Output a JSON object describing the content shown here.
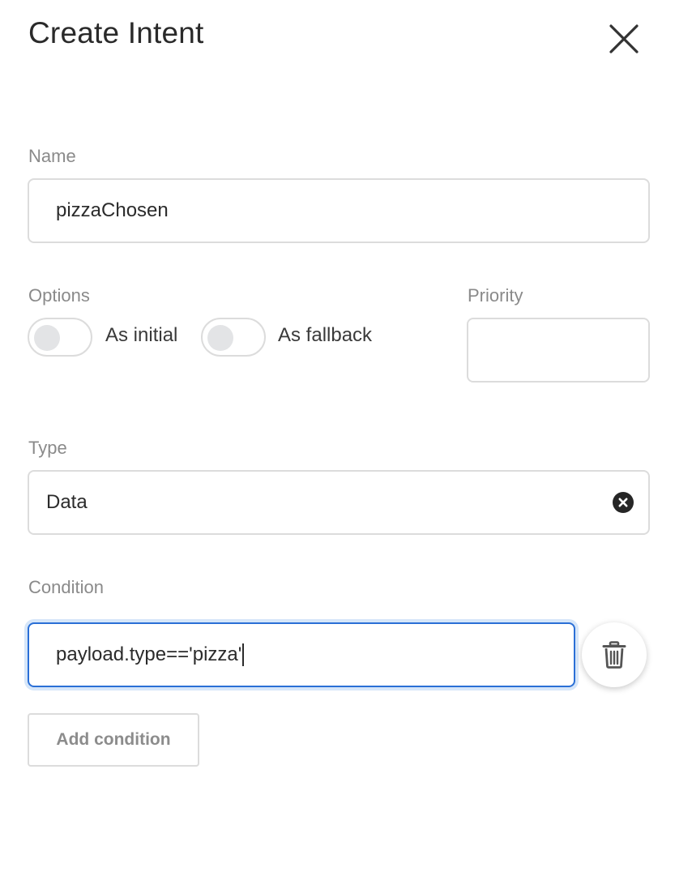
{
  "dialog": {
    "title": "Create Intent"
  },
  "fields": {
    "name": {
      "label": "Name",
      "value": "pizzaChosen"
    },
    "options": {
      "label": "Options",
      "toggles": [
        {
          "label": "As initial",
          "checked": false
        },
        {
          "label": "As fallback",
          "checked": false
        }
      ]
    },
    "priority": {
      "label": "Priority",
      "value": ""
    },
    "type": {
      "label": "Type",
      "value": "Data"
    },
    "condition": {
      "label": "Condition",
      "value": "payload.type=='pizza'"
    }
  },
  "buttons": {
    "add_condition": "Add condition"
  },
  "icons": {
    "close": "close-icon",
    "clear": "clear-icon",
    "delete": "trash-icon"
  },
  "colors": {
    "focus_border": "#2a6fd6",
    "border": "#dcdcdc",
    "label": "#8a8a8a"
  }
}
